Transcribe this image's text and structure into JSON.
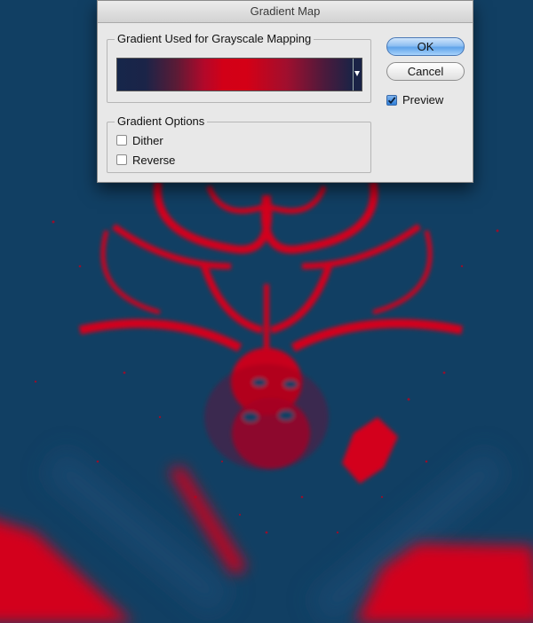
{
  "dialog": {
    "title": "Gradient Map",
    "gradient_group_title": "Gradient Used for Grayscale Mapping",
    "options_group_title": "Gradient Options",
    "dither_label": "Dither",
    "dither_checked": false,
    "reverse_label": "Reverse",
    "reverse_checked": false,
    "ok_label": "OK",
    "cancel_label": "Cancel",
    "preview_label": "Preview",
    "preview_checked": true
  },
  "colors": {
    "canvas_background": "#113f63",
    "figure_red": "#d3001a",
    "gradient_dark": "#16264a",
    "gradient_red": "#d20017"
  }
}
